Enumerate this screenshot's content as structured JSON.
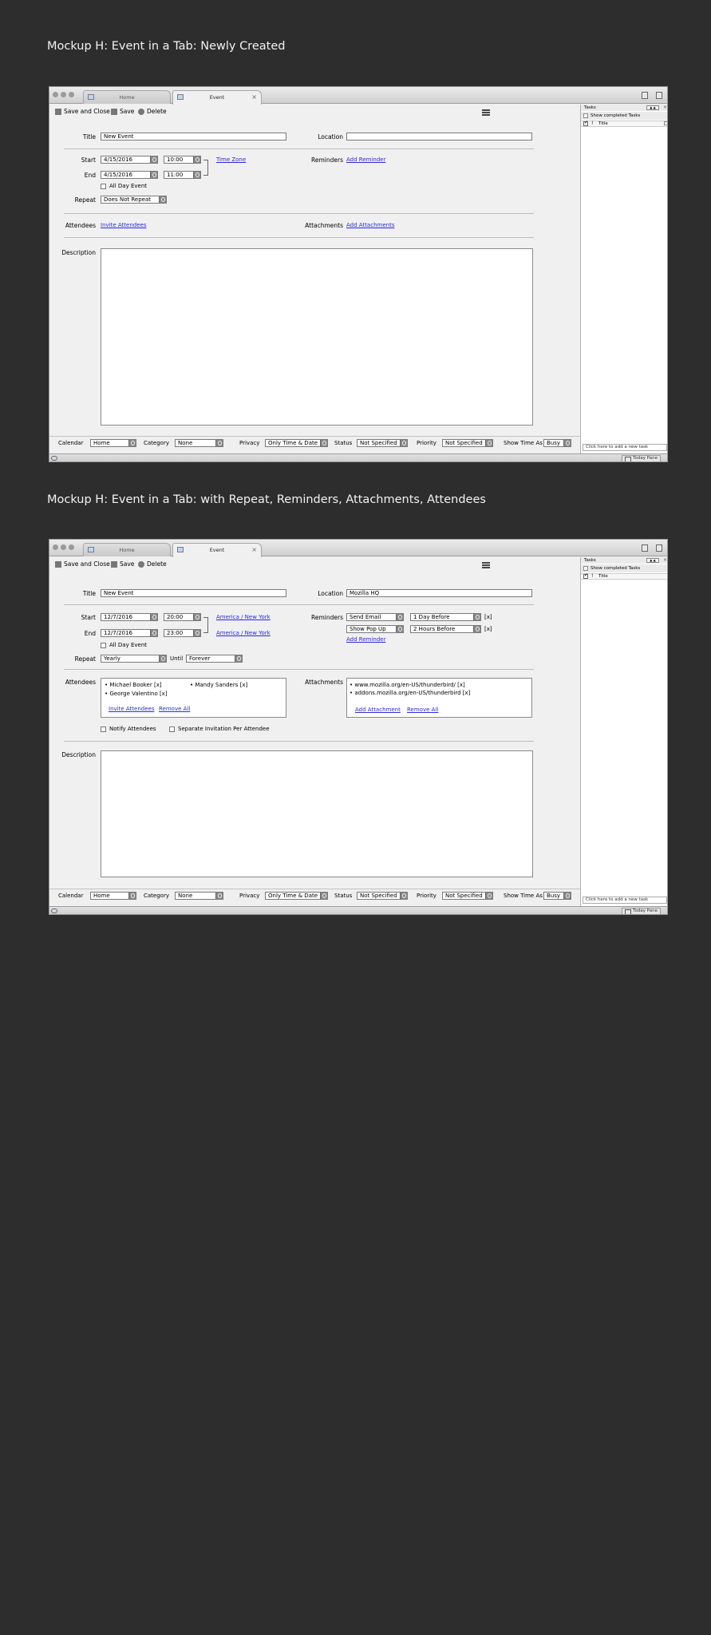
{
  "mockups": [
    {
      "heading": "Mockup H:  Event in a Tab:  Newly Created",
      "tabs": {
        "home": "Home",
        "event": "Event"
      },
      "toolbar": {
        "save_close": "Save and Close",
        "save": "Save",
        "delete": "Delete"
      },
      "labels": {
        "title": "Title",
        "location": "Location",
        "start": "Start",
        "end": "End",
        "all_day": "All Day Event",
        "repeat": "Repeat",
        "reminders": "Reminders",
        "attendees": "Attendees",
        "attachments": "Attachments",
        "description": "Description"
      },
      "values": {
        "title": "New Event",
        "location": "",
        "start_date": "4/15/2016",
        "start_time": "10:00",
        "end_date": "4/15/2016",
        "end_time": "11:00",
        "repeat": "Does Not Repeat"
      },
      "links": {
        "time_zone": "Time Zone",
        "add_reminder": "Add Reminder",
        "invite_attendees": "Invite Attendees",
        "add_attachments": "Add Attachments"
      },
      "status": {
        "calendar_label": "Calendar",
        "calendar_value": "Home",
        "category_label": "Category",
        "category_value": "None",
        "privacy_label": "Privacy",
        "privacy_value": "Only Time & Date",
        "status_label": "Status",
        "status_value": "Not Specified",
        "priority_label": "Priority",
        "priority_value": "Not Specified",
        "show_as_label": "Show Time As",
        "show_as_value": "Busy"
      },
      "tasks": {
        "header": "Tasks",
        "show_completed": "Show completed Tasks",
        "title_col": "Title",
        "new_task": "Click here to add a new task"
      },
      "today_pane": "Today Pane"
    },
    {
      "heading": "Mockup H:  Event in a Tab: with Repeat, Reminders, Attachments, Attendees",
      "tabs": {
        "home": "Home",
        "event": "Event"
      },
      "toolbar": {
        "save_close": "Save and Close",
        "save": "Save",
        "delete": "Delete"
      },
      "labels": {
        "title": "Title",
        "location": "Location",
        "start": "Start",
        "end": "End",
        "all_day": "All Day Event",
        "repeat": "Repeat",
        "until": "Until",
        "reminders": "Reminders",
        "attendees": "Attendees",
        "attachments": "Attachments",
        "description": "Description",
        "notify_attendees": "Notify Attendees",
        "separate_invitation": "Separate Invitation Per Attendee"
      },
      "values": {
        "title": "New Event",
        "location": "Mozilla HQ",
        "start_date": "12/7/2016",
        "start_time": "20:00",
        "end_date": "12/7/2016",
        "end_time": "23:00",
        "repeat": "Yearly",
        "until": "Forever",
        "start_tz": "America / New York",
        "end_tz": "America / New York"
      },
      "reminders": [
        {
          "type": "Send Email",
          "when": "1 Day Before",
          "remove": "[x]"
        },
        {
          "type": "Show Pop Up",
          "when": "2 Hours Before",
          "remove": "[x]"
        }
      ],
      "attendees": [
        "• Michael Booker [x]",
        "• Mandy Sanders [x]",
        "• George Valentino [x]"
      ],
      "attachments": [
        "• www.mozilla.org/en-US/thunderbird/ [x]",
        "• addons.mozilla.org/en-US/thunderbird [x]"
      ],
      "links": {
        "add_reminder": "Add Reminder",
        "invite_attendees": "Invite Attendees",
        "remove_all_attendees": "Remove All",
        "add_attachment": "Add Attachment",
        "remove_all_attachments": "Remove All"
      },
      "status": {
        "calendar_label": "Calendar",
        "calendar_value": "Home",
        "category_label": "Category",
        "category_value": "None",
        "privacy_label": "Privacy",
        "privacy_value": "Only Time & Date",
        "status_label": "Status",
        "status_value": "Not Specified",
        "priority_label": "Priority",
        "priority_value": "Not Specified",
        "show_as_label": "Show Time As",
        "show_as_value": "Busy"
      },
      "tasks": {
        "header": "Tasks",
        "show_completed": "Show completed Tasks",
        "title_col": "Title",
        "new_task": "Click here to add a new task"
      },
      "today_pane": "Today Pane"
    }
  ]
}
